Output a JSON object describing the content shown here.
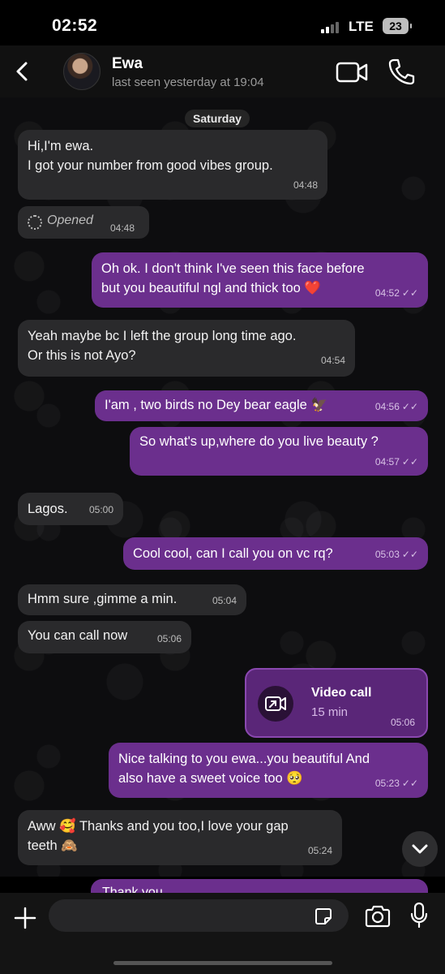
{
  "status_bar": {
    "time": "02:52",
    "network": "LTE",
    "battery": "23"
  },
  "header": {
    "name": "Ewa",
    "last_seen": "last seen yesterday at 19:04"
  },
  "date_label": "Saturday",
  "messages": [
    {
      "dir": "in",
      "lines": [
        "Hi,I'm ewa.",
        "I got your number from good vibes group."
      ],
      "time": "04:48"
    },
    {
      "dir": "in",
      "type": "opened",
      "text": "Opened",
      "time": "04:48"
    },
    {
      "dir": "out",
      "lines": [
        "Oh ok. I don't think I've seen this face before",
        "but you beautiful ngl and thick too ❤️"
      ],
      "time": "04:52"
    },
    {
      "dir": "in",
      "lines": [
        "Yeah maybe bc I left the group long time ago.",
        "Or this is not Ayo?"
      ],
      "time": "04:54"
    },
    {
      "dir": "out",
      "lines": [
        "I'am , two birds no Dey bear eagle 🦅"
      ],
      "time": "04:56"
    },
    {
      "dir": "out",
      "lines": [
        "So what's up,where do you live beauty ?"
      ],
      "time": "04:57"
    },
    {
      "dir": "in",
      "lines": [
        "Lagos."
      ],
      "time": "05:00"
    },
    {
      "dir": "out",
      "lines": [
        "Cool cool, can I call you on vc rq?"
      ],
      "time": "05:03"
    },
    {
      "dir": "in",
      "lines": [
        "Hmm sure ,gimme a min."
      ],
      "time": "05:04"
    },
    {
      "dir": "in",
      "lines": [
        "You can call now"
      ],
      "time": "05:06"
    },
    {
      "dir": "out",
      "type": "call",
      "title": "Video call",
      "duration": "15 min",
      "time": "05:06"
    },
    {
      "dir": "out",
      "lines": [
        "Nice talking to you ewa...you beautiful And",
        "also have a sweet voice too 🥺"
      ],
      "time": "05:23"
    },
    {
      "dir": "in",
      "lines": [
        "Aww 🥰 Thanks and you too,I love your gap",
        "teeth 🙈"
      ],
      "time": "05:24"
    },
    {
      "dir": "out",
      "lines": [
        "Thank you"
      ],
      "time": ""
    }
  ],
  "ticks": "✓✓",
  "input": {
    "placeholder": ""
  },
  "colors": {
    "outgoing": "#6b2f8d",
    "incoming": "#2a2a2c",
    "background": "#0d0d0f"
  }
}
